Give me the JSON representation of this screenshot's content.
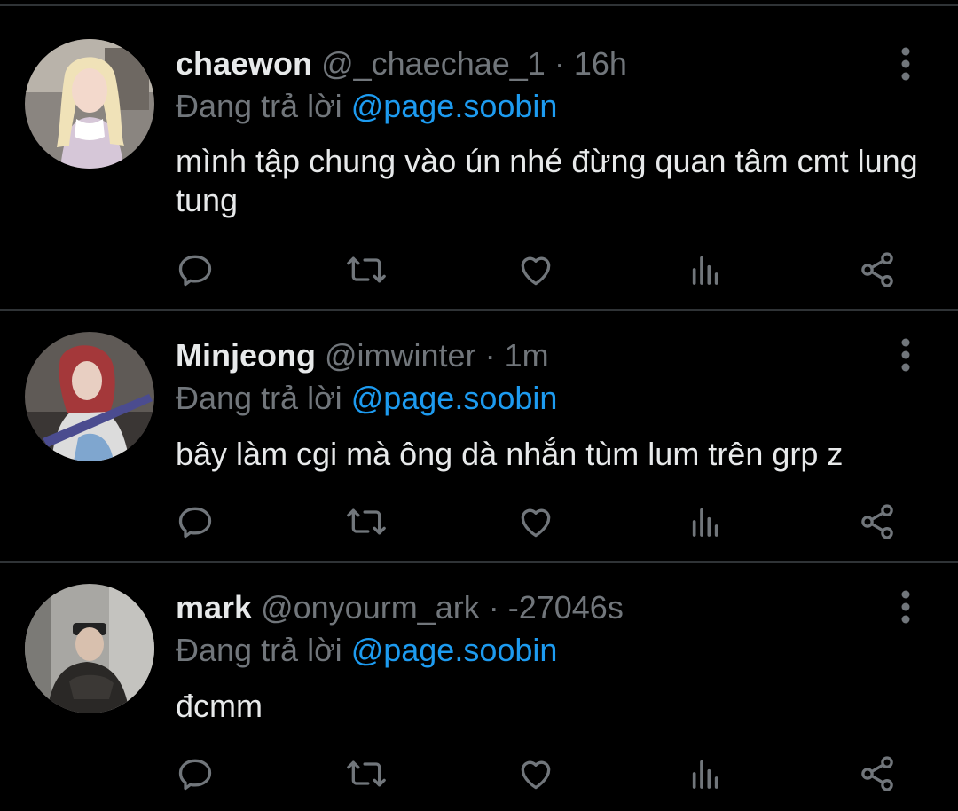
{
  "colors": {
    "background": "#000000",
    "divider": "#2f3336",
    "primary_text": "#e7e9ea",
    "secondary_text": "#71767b",
    "link": "#1d9bf0"
  },
  "action_icons": [
    "reply-icon",
    "retweet-icon",
    "like-icon",
    "views-icon",
    "share-icon"
  ],
  "tweets": [
    {
      "display_name": "chaewon",
      "handle": "@_chaechae_1",
      "separator": " · ",
      "time": "16h",
      "reply_prefix": "Đang trả lời ",
      "reply_to": "@page.soobin",
      "text": "mình tập chung vào ún nhé đừng quan tâm cmt lung tung"
    },
    {
      "display_name": "Minjeong",
      "handle": "@imwinter",
      "separator": " · ",
      "time": "1m",
      "reply_prefix": "Đang trả lời ",
      "reply_to": "@page.soobin",
      "text": "bây làm cgi mà ông dà nhắn tùm lum trên grp z"
    },
    {
      "display_name": "mark",
      "handle": "@onyourm_ark",
      "separator": " · ",
      "time": "-27046s",
      "reply_prefix": "Đang trả lời ",
      "reply_to": "@page.soobin",
      "text": "đcmm"
    }
  ]
}
